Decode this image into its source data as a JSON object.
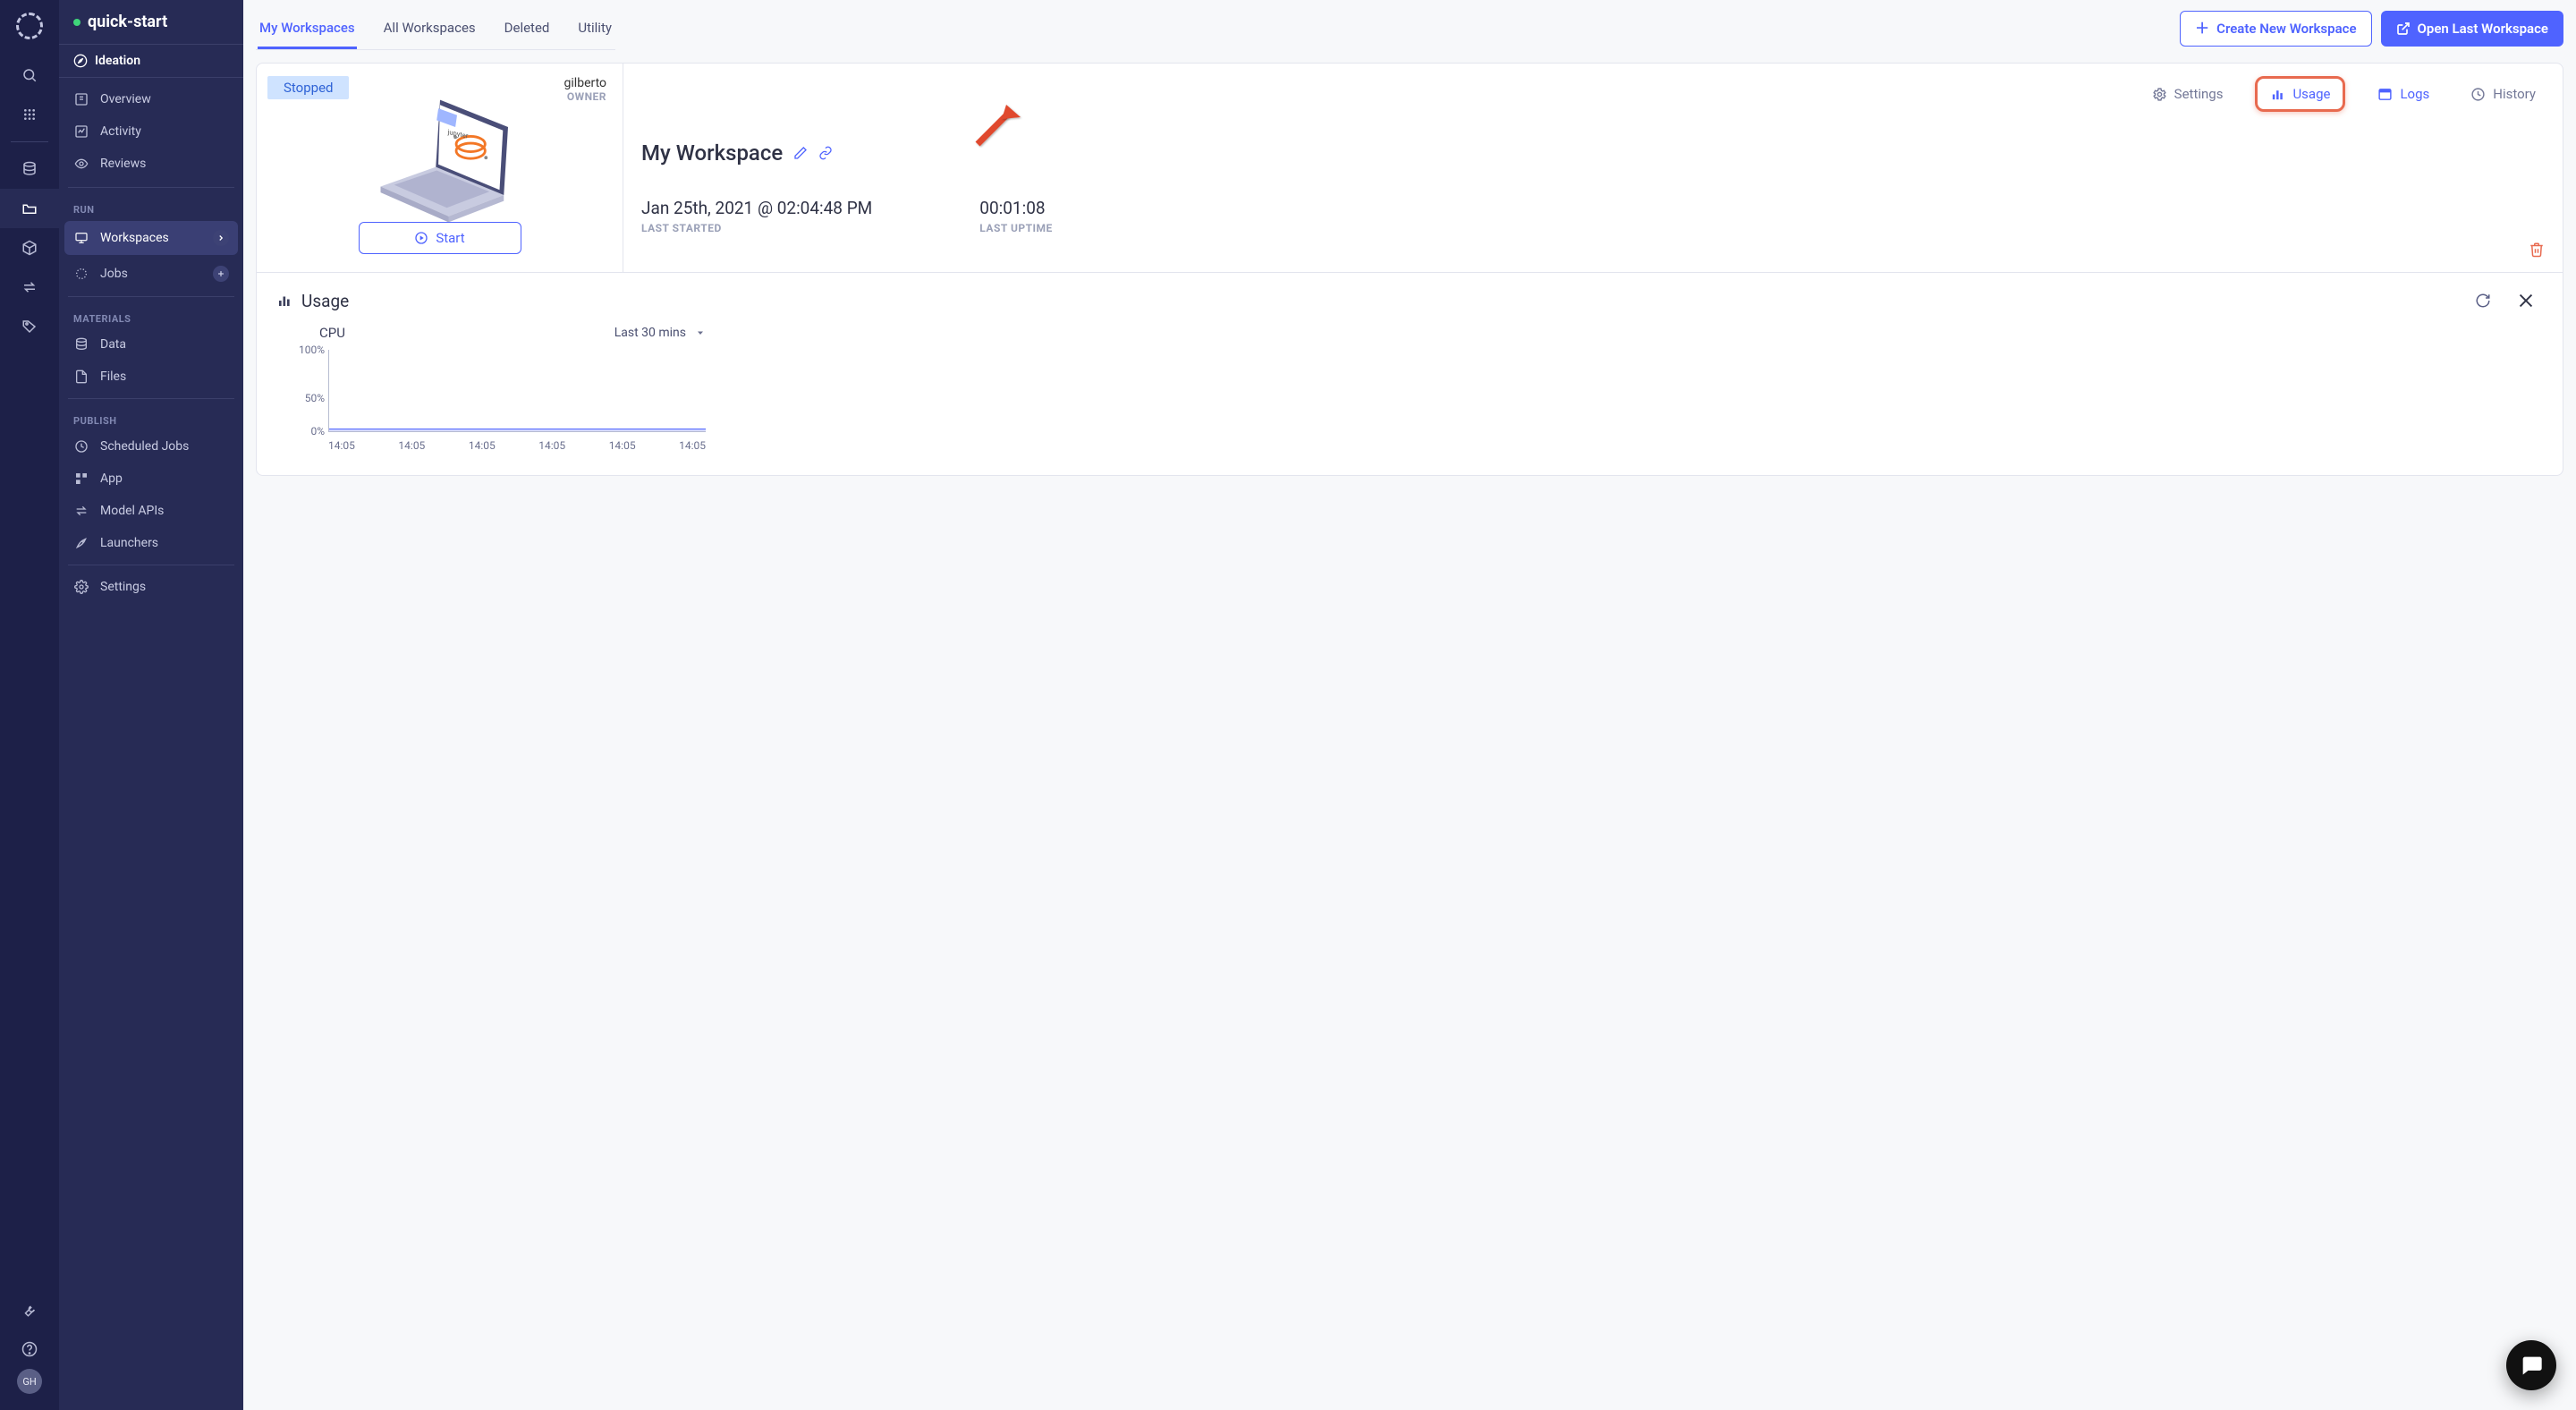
{
  "project": {
    "name": "quick-start",
    "section": "Ideation"
  },
  "avatar": "GH",
  "sidebar": {
    "top": [
      {
        "label": "Overview"
      },
      {
        "label": "Activity"
      },
      {
        "label": "Reviews"
      }
    ],
    "run_heading": "RUN",
    "run": [
      {
        "label": "Workspaces",
        "active": true,
        "trail": "chevron"
      },
      {
        "label": "Jobs",
        "trail": "plus"
      }
    ],
    "materials_heading": "MATERIALS",
    "materials": [
      {
        "label": "Data"
      },
      {
        "label": "Files"
      }
    ],
    "publish_heading": "PUBLISH",
    "publish": [
      {
        "label": "Scheduled Jobs"
      },
      {
        "label": "App"
      },
      {
        "label": "Model APIs"
      },
      {
        "label": "Launchers"
      }
    ],
    "settings_label": "Settings"
  },
  "tabs": [
    {
      "label": "My Workspaces",
      "active": true
    },
    {
      "label": "All Workspaces"
    },
    {
      "label": "Deleted"
    },
    {
      "label": "Utility"
    }
  ],
  "actions": {
    "create": "Create New Workspace",
    "open_last": "Open Last Workspace"
  },
  "workspace": {
    "status": "Stopped",
    "owner_name": "gilberto",
    "owner_role": "OWNER",
    "start_label": "Start",
    "title": "My Workspace",
    "last_started": "Jan 25th, 2021 @ 02:04:48 PM",
    "last_started_label": "LAST STARTED",
    "uptime": "00:01:08",
    "uptime_label": "LAST UPTIME",
    "detail_tabs": {
      "settings": "Settings",
      "usage": "Usage",
      "logs": "Logs",
      "history": "History"
    }
  },
  "usage": {
    "title": "Usage",
    "chart_title": "CPU",
    "range": "Last 30 mins"
  },
  "chart_data": {
    "type": "area",
    "title": "CPU",
    "xlabel": "",
    "ylabel": "",
    "ylim": [
      0,
      100
    ],
    "y_ticks": [
      "100%",
      "50%",
      "0%"
    ],
    "x_ticks": [
      "14:05",
      "14:05",
      "14:05",
      "14:05",
      "14:05",
      "14:05"
    ],
    "series": [
      {
        "name": "CPU",
        "values": [
          3,
          3,
          3,
          3,
          3,
          3
        ]
      }
    ]
  }
}
